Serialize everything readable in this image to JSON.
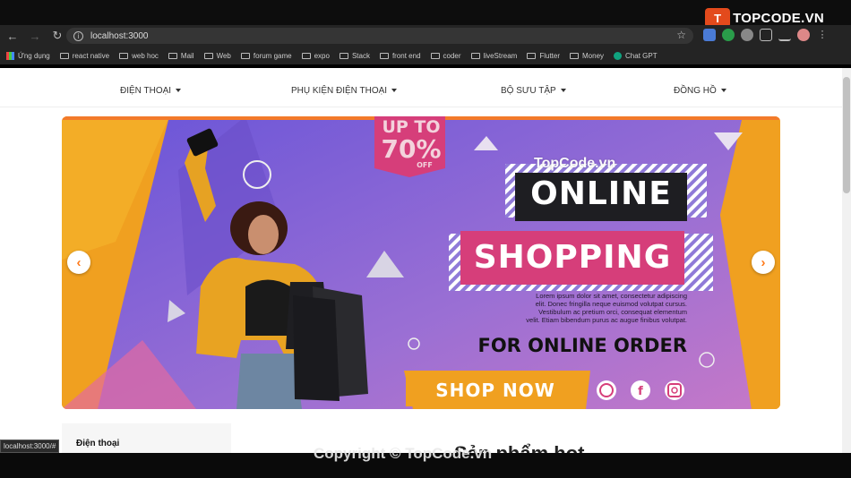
{
  "browser": {
    "url": "localhost:3000",
    "status_url": "localhost:3000/#",
    "logo_mark": "T",
    "logo_text": "TOPCODE.VN",
    "bookmarks": [
      {
        "label": "Ứng dụng",
        "icon": "apps-icon"
      },
      {
        "label": "react native",
        "icon": "folder-icon"
      },
      {
        "label": "web hoc",
        "icon": "folder-icon"
      },
      {
        "label": "Mail",
        "icon": "folder-icon"
      },
      {
        "label": "Web",
        "icon": "folder-icon"
      },
      {
        "label": "forum game",
        "icon": "folder-icon"
      },
      {
        "label": "expo",
        "icon": "folder-icon"
      },
      {
        "label": "Stack",
        "icon": "folder-icon"
      },
      {
        "label": "front end",
        "icon": "folder-icon"
      },
      {
        "label": "coder",
        "icon": "folder-icon"
      },
      {
        "label": "liveStream",
        "icon": "folder-icon"
      },
      {
        "label": "Flutter",
        "icon": "folder-icon"
      },
      {
        "label": "Money",
        "icon": "folder-icon"
      },
      {
        "label": "Chat GPT",
        "icon": "chatgpt-icon"
      }
    ]
  },
  "nav": {
    "items": [
      {
        "label": "ĐIỆN THOẠI"
      },
      {
        "label": "PHỤ KIỆN ĐIỆN THOẠI"
      },
      {
        "label": "BỘ SƯU TẬP"
      },
      {
        "label": "ĐỒNG HỒ"
      }
    ]
  },
  "banner": {
    "upto_line1": "UP TO",
    "upto_line2": "70%",
    "upto_line3": "OFF",
    "word1": "ONLINE",
    "word2": "SHOPPING",
    "lorem": [
      "Lorem ipsum dolor sit amet, consectetur adipiscing",
      "elit. Donec fringilla neque euismod volutpat cursus.",
      "Vestibulum ac pretium orci, consequat elementum",
      "velit. Etiam bibendum purus ac augue finibus volutpat."
    ],
    "tagline": "FOR ONLINE ORDER",
    "cta": "SHOP NOW",
    "watermark": "TopCode.vn",
    "prev_arrow": "‹",
    "next_arrow": "›"
  },
  "sidebar": {
    "first_item": "Điện thoại"
  },
  "main": {
    "section_title": "Sản phẩm hot"
  },
  "overlay": {
    "copyright": "Copyright © TopCode.vn"
  },
  "colors": {
    "accent": "#ff7a1a",
    "banner_purple": "#7b5cd6",
    "banner_orange": "#f0a020",
    "banner_pink": "#d63e7a"
  }
}
